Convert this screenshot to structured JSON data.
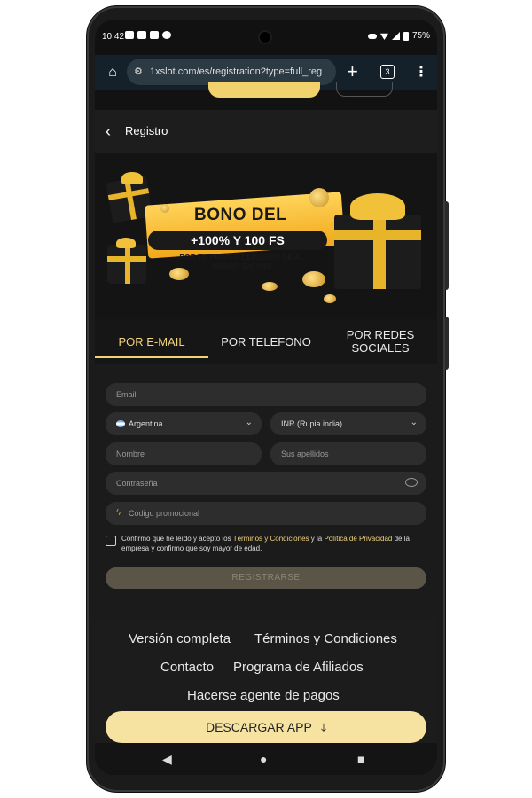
{
  "status": {
    "time": "10:42",
    "battery": "75%"
  },
  "browser": {
    "url": "1xslot.com/es/registration?type=full_reg",
    "tab_count": "3"
  },
  "header": {
    "title": "Registro"
  },
  "banner": {
    "headline": "BONO DEL",
    "pill": "+100% Y 100 FS",
    "subtext": "POR TU PRIMER DEPOSITO DE AL MENOS 500 INR!"
  },
  "tabs": [
    {
      "label": "POR E-MAIL"
    },
    {
      "label": "POR TELEFONO"
    },
    {
      "label": "POR REDES SOCIALES"
    }
  ],
  "form": {
    "email_placeholder": "Email",
    "country": "Argentina",
    "currency": "INR (Rupia india)",
    "name_placeholder": "Nombre",
    "surname_placeholder": "Sus apellidos",
    "password_placeholder": "Contraseña",
    "promo_placeholder": "Código promocional",
    "terms_part1": "Confirmo que he leído y acepto los ",
    "terms_link1": "Términos y Condiciones",
    "terms_part2": " y la ",
    "terms_link2": "Política de Privacidad",
    "terms_part3": " de la empresa y confirmo que soy mayor de edad.",
    "register_label": "REGISTRARSE"
  },
  "footer": {
    "full_version": "Versión completa",
    "terms": "Términos y Condiciones",
    "contact": "Contacto",
    "affiliates": "Programa de Afiliados",
    "payment_agent": "Hacerse agente de pagos",
    "download": "DESCARGAR APP"
  },
  "colors": {
    "accent": "#f3d37a",
    "download_bg": "#f6e3a2",
    "register_bg": "#5b5548"
  }
}
